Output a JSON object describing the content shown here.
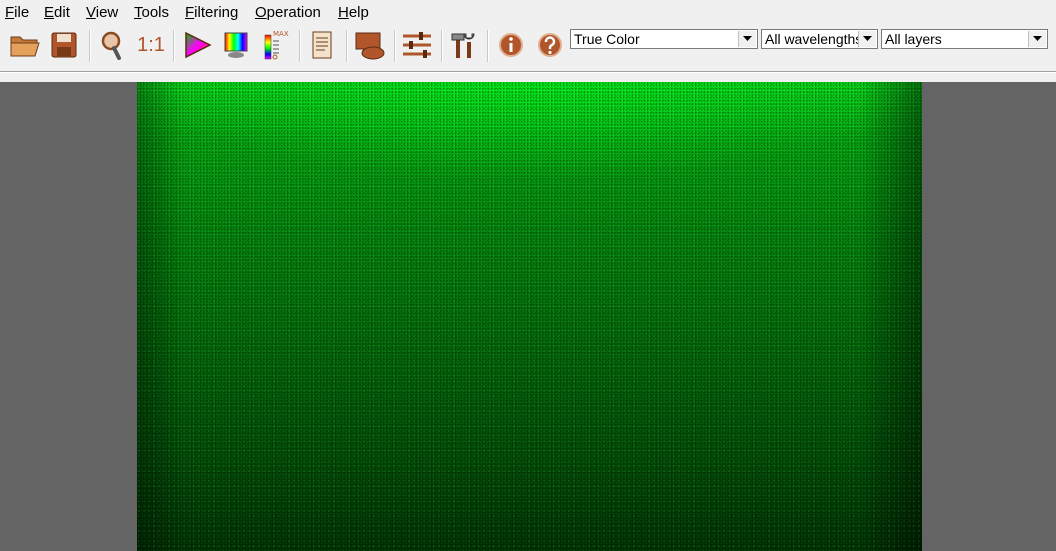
{
  "menu": {
    "file": {
      "acc": "F",
      "rest": "ile"
    },
    "edit": {
      "acc": "E",
      "rest": "dit"
    },
    "view": {
      "acc": "V",
      "rest": "iew"
    },
    "tools": {
      "acc": "T",
      "rest": "ools"
    },
    "filtering": {
      "acc": "F",
      "rest": "iltering"
    },
    "operation": {
      "acc": "O",
      "rest": "peration"
    },
    "help": {
      "acc": "H",
      "rest": "elp"
    }
  },
  "toolbar": {
    "one_to_one_label": "1:1",
    "max_label": "MAX",
    "color_mode": "True Color",
    "wavelengths": "All wavelengths",
    "layers": "All layers"
  },
  "colors": {
    "icon_brown": "#b0562a",
    "viewport_bg": "#646464",
    "image_green": "#07a813"
  }
}
